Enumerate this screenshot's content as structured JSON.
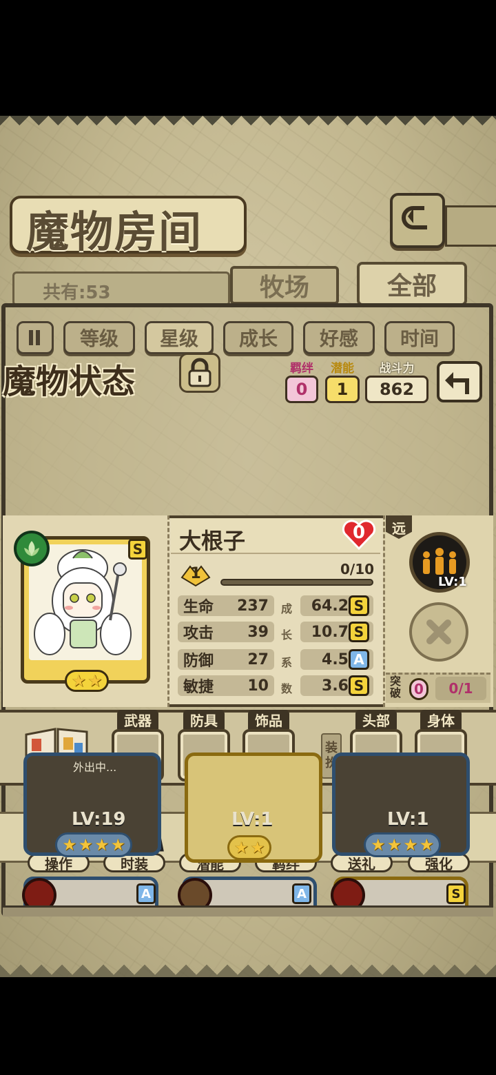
{
  "header": {
    "title": "魔物房间"
  },
  "counter": {
    "text": "共有:53"
  },
  "tabs": {
    "ranch": "牧场",
    "all": "全部"
  },
  "sort": {
    "items": [
      "等级",
      "星级",
      "成长",
      "好感",
      "时间"
    ],
    "active": "星级"
  },
  "status": {
    "title": "魔物状态",
    "bond_label": "羁绊",
    "bond_value": "0",
    "potential_label": "潜能",
    "potential_value": "1",
    "power_label": "战斗力",
    "power_value": "862"
  },
  "monster": {
    "name": "大根子",
    "rarity": "S",
    "element_icon": "leaf-icon",
    "stars": 2,
    "affection": "0",
    "level": "1",
    "xp": "0/10",
    "xp_progress": 0,
    "stats": [
      {
        "name": "生命",
        "value": "237",
        "growth": "64.2",
        "grade": "S"
      },
      {
        "name": "攻击",
        "value": "39",
        "growth": "10.7",
        "grade": "S"
      },
      {
        "name": "防御",
        "value": "27",
        "growth": "4.5",
        "grade": "A"
      },
      {
        "name": "敏捷",
        "value": "10",
        "growth": "3.6",
        "grade": "S"
      }
    ],
    "growth_label_chars": [
      "成",
      "长",
      "系",
      "数"
    ]
  },
  "skill": {
    "range_tag": "远",
    "level": "LV:1"
  },
  "breakthrough": {
    "label": "突破",
    "count": "0",
    "progress": "0/1"
  },
  "equipment": {
    "codex_label": "图鉴",
    "dress_label": "装扮",
    "slots": [
      "武器",
      "防具",
      "饰品",
      "头部",
      "身体"
    ]
  },
  "actions": [
    {
      "label": "操作",
      "icon": "gear-icon"
    },
    {
      "label": "时装",
      "icon": "outfit-icon"
    },
    {
      "label": "潜能",
      "icon": "demon-icon"
    },
    {
      "label": "羁绊",
      "icon": "hearts-icon"
    },
    {
      "label": "送礼",
      "icon": "gift-icon"
    },
    {
      "label": "强化",
      "icon": "upgrade-arrows-icon"
    }
  ],
  "roster": [
    {
      "level": "LV:19",
      "stars": 4,
      "status": "外出中..."
    },
    {
      "level": "LV:1",
      "stars": 2,
      "status": ""
    },
    {
      "level": "LV:1",
      "stars": 4,
      "status": ""
    }
  ],
  "roster_row2_grades": [
    "A",
    "A",
    "S"
  ]
}
